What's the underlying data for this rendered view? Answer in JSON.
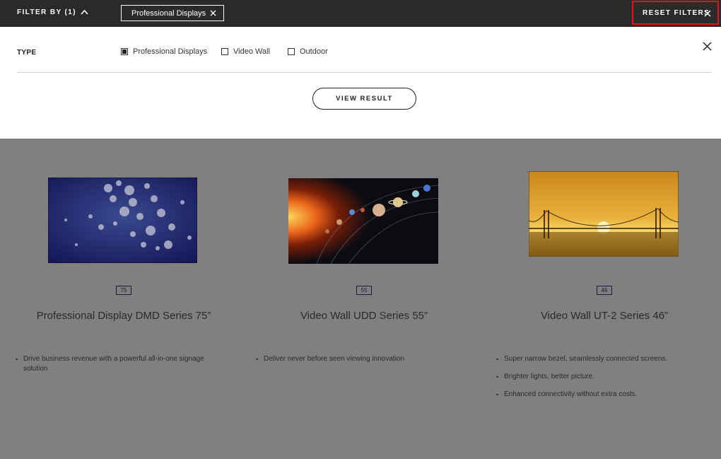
{
  "filter_bar": {
    "toggle_label": "FILTER BY (1)",
    "active_chip": "Professional Displays",
    "reset_label": "RESET FILTERS"
  },
  "filter_panel": {
    "type_label": "TYPE",
    "options": [
      {
        "label": "Professional Displays",
        "checked": true
      },
      {
        "label": "Video Wall",
        "checked": false
      },
      {
        "label": "Outdoor",
        "checked": false
      }
    ],
    "view_result_label": "VIEW RESULT"
  },
  "products": [
    {
      "size": "75",
      "title": "Professional Display DMD Series 75”",
      "bullets": [
        "Drive business revenue with a powerful all-in-one signage solution"
      ],
      "image": "bokeh-lights-image"
    },
    {
      "size": "55",
      "title": "Video Wall UDD Series 55”",
      "bullets": [
        "Deliver never before seen viewing innovation"
      ],
      "image": "solar-system-image"
    },
    {
      "size": "46",
      "title": "Video Wall UT-2 Series 46”",
      "bullets": [
        "Super narrow bezel, seamlessly connected screens.",
        "Brighter lights, better picture.",
        "Enhanced connectivity without extra costs."
      ],
      "image": "bridge-sunset-image"
    }
  ],
  "colors": {
    "topbar": "#2a2a2a",
    "overlay": "#808080",
    "highlight": "#e5121b"
  }
}
